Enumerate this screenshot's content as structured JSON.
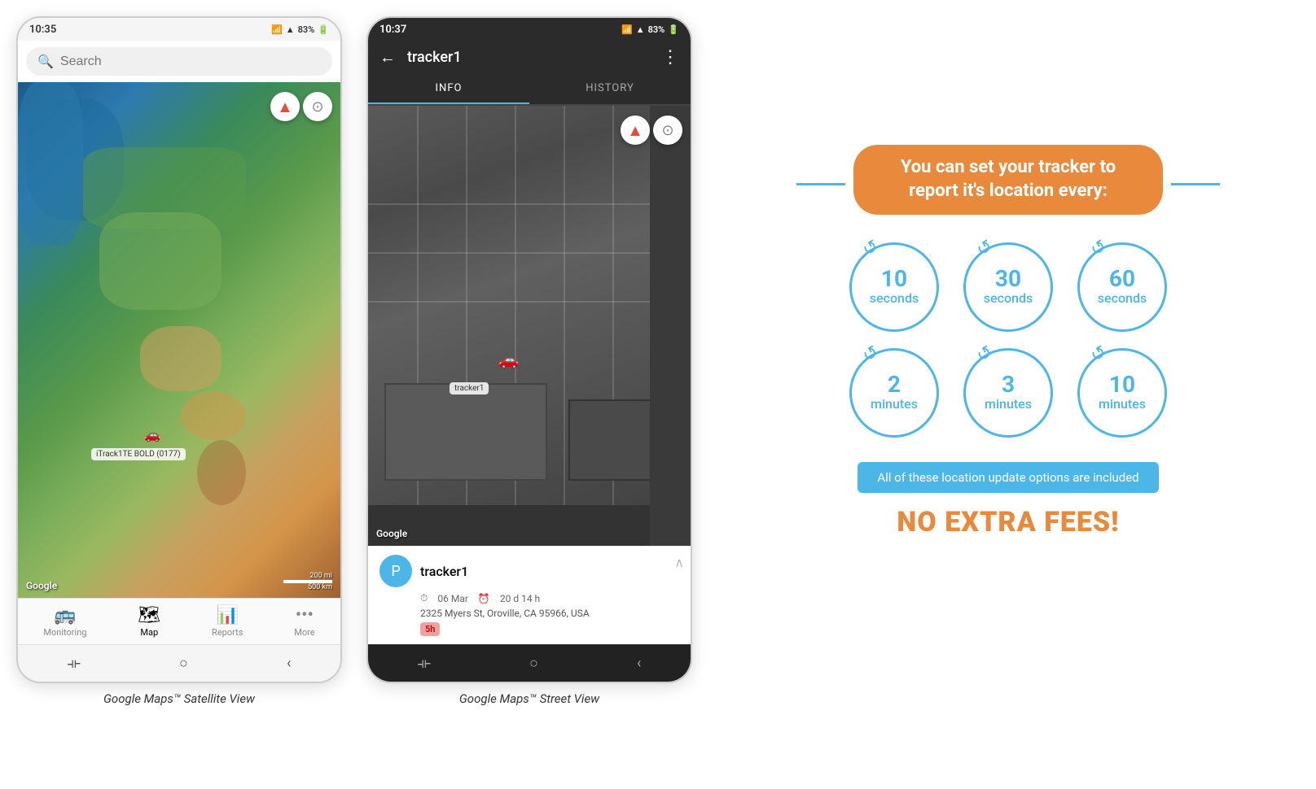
{
  "phones": {
    "phone1": {
      "status_time": "10:35",
      "status_signal": "▲▲▲",
      "status_battery": "83%",
      "search_placeholder": "Search",
      "compass": "▲",
      "google_watermark": "Google",
      "scale_200mi": "200 mi",
      "scale_500km": "500 km",
      "tracker_label": "iTrack1TE BOLD (0177)",
      "nav_items": [
        {
          "icon": "🚌",
          "label": "Monitoring",
          "active": false
        },
        {
          "icon": "🗺",
          "label": "Map",
          "active": true
        },
        {
          "icon": "📊",
          "label": "Reports",
          "active": false
        },
        {
          "icon": "•••",
          "label": "More",
          "active": false
        }
      ],
      "caption": "Google Maps™ Satellite View"
    },
    "phone2": {
      "status_time": "10:37",
      "status_signal": "▲▲▲",
      "status_battery": "83%",
      "back_icon": "←",
      "title": "tracker1",
      "more_icon": "⋮",
      "tabs": [
        {
          "label": "INFO",
          "active": true
        },
        {
          "label": "HISTORY",
          "active": false
        }
      ],
      "google_watermark": "Google",
      "tracker_name": "tracker1",
      "tracker_icon": "P",
      "date": "06 Mar",
      "duration": "20 d 14 h",
      "address": "2325 Myers St, Oroville, CA 95966, USA",
      "badge": "5h",
      "caption": "Google Maps™ Street View"
    }
  },
  "infographic": {
    "title": "You can set your tracker to report it's location every:",
    "circles": [
      {
        "number": "10",
        "unit": "seconds"
      },
      {
        "number": "30",
        "unit": "seconds"
      },
      {
        "number": "60",
        "unit": "seconds"
      },
      {
        "number": "2",
        "unit": "minutes"
      },
      {
        "number": "3",
        "unit": "minutes"
      },
      {
        "number": "10",
        "unit": "minutes"
      }
    ],
    "included_text": "All of these location update options are included",
    "no_fees_text": "NO EXTRA FEES!",
    "accent_color": "#e8893c",
    "blue_color": "#4db6e8"
  }
}
